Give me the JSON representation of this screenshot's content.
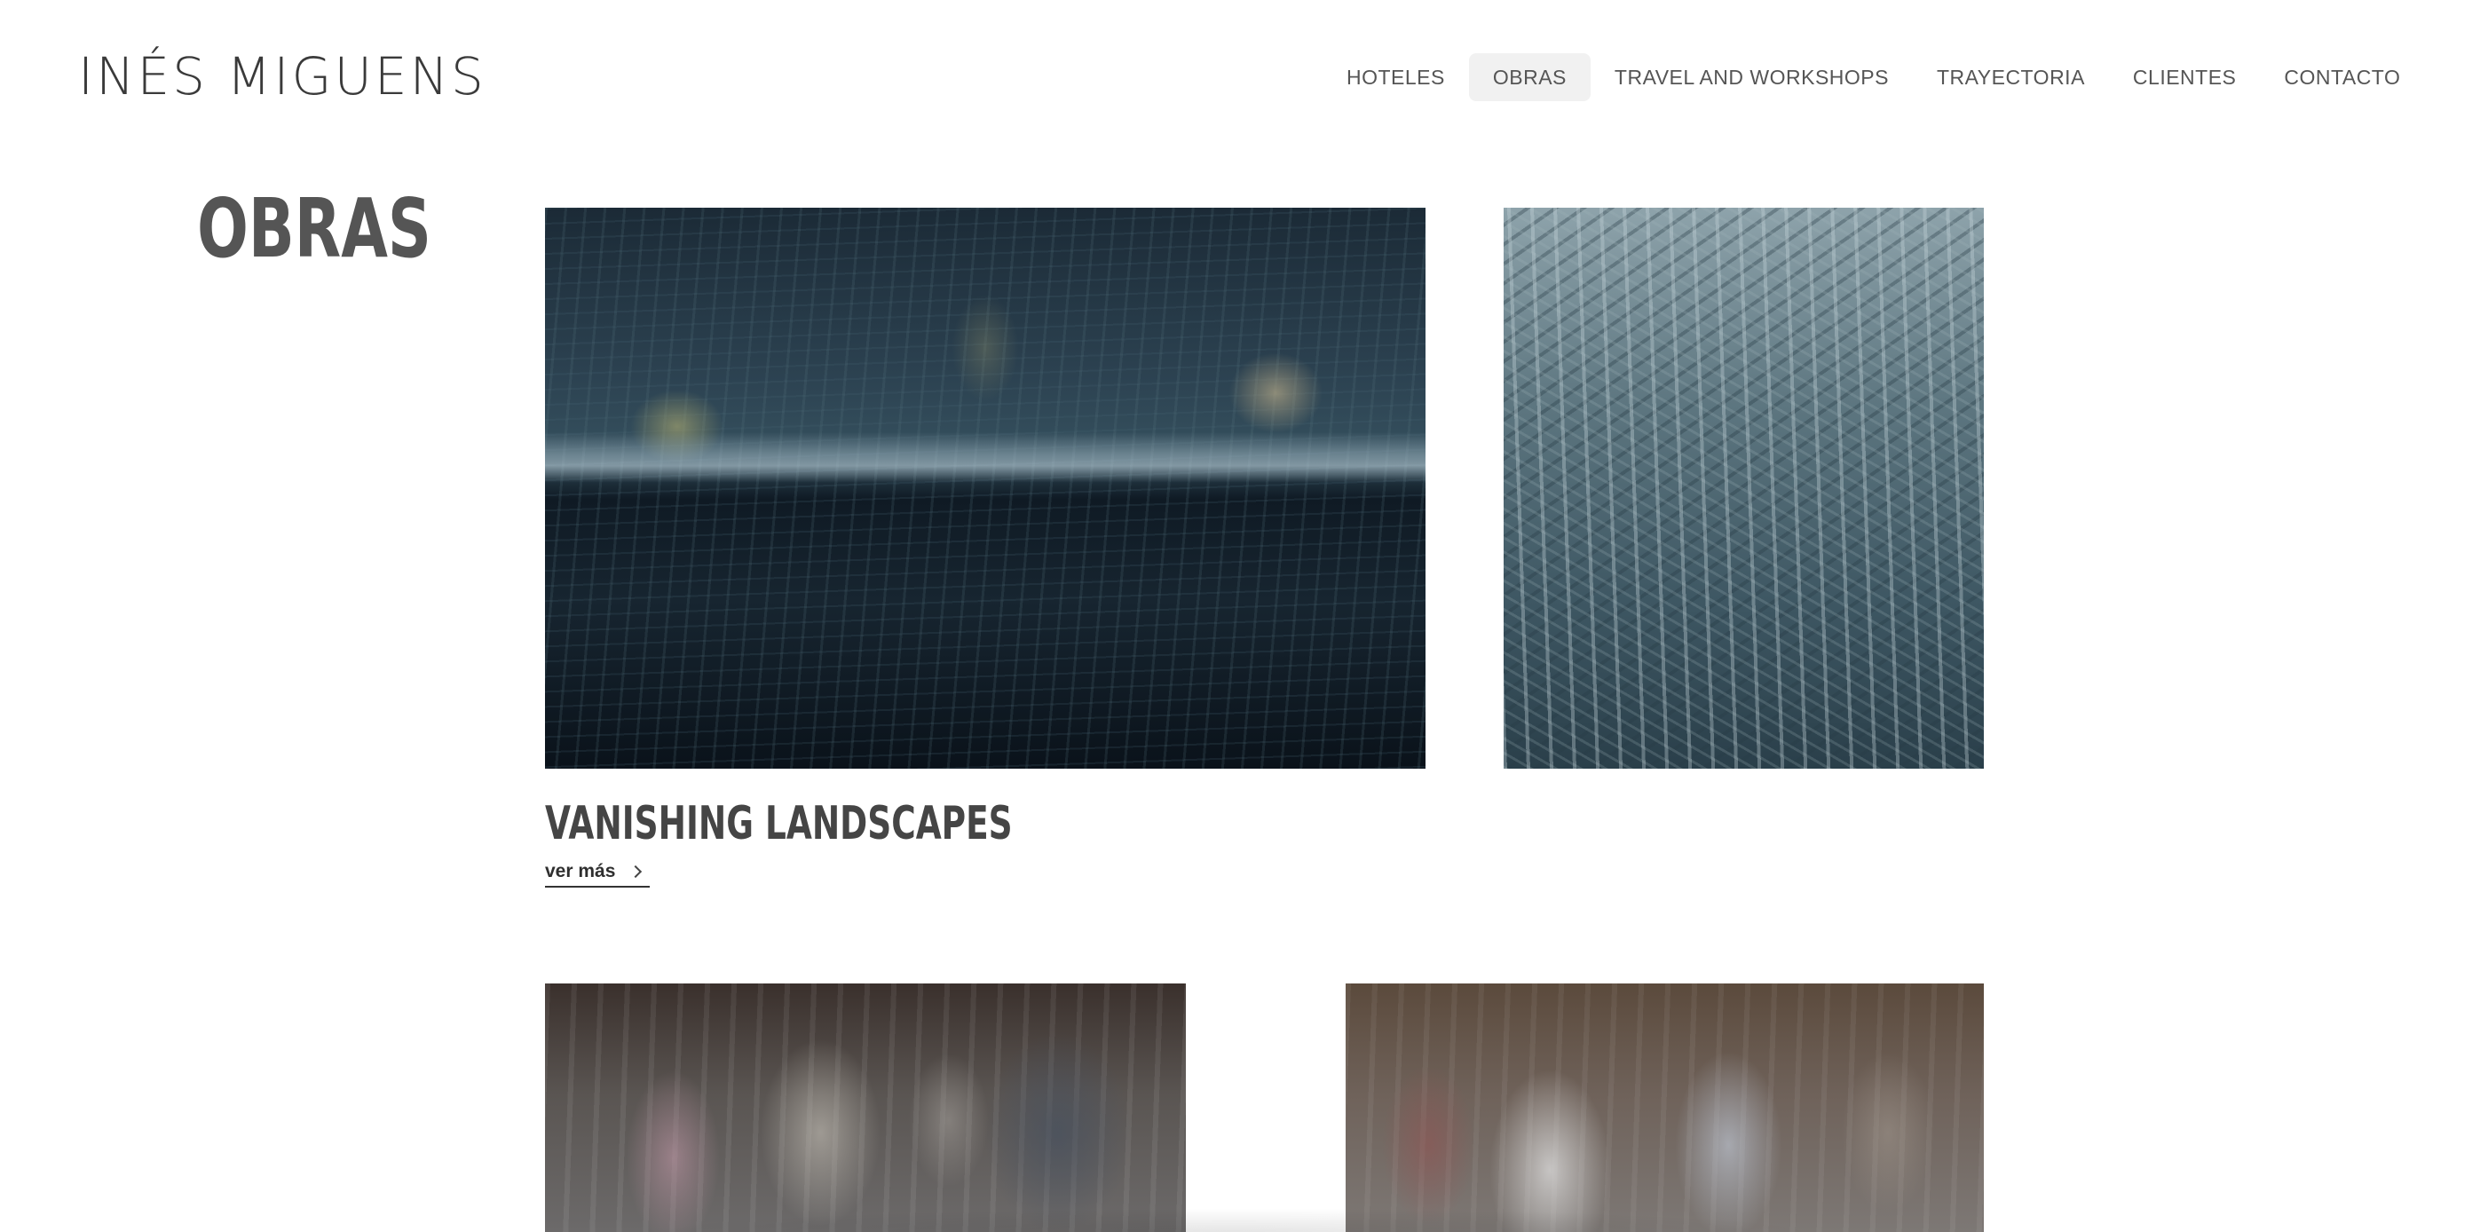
{
  "header": {
    "logo": "INÉS MIGUENS",
    "nav": [
      {
        "label": "HOTELES"
      },
      {
        "label": "OBRAS",
        "active": true
      },
      {
        "label": "TRAVEL AND WORKSHOPS"
      },
      {
        "label": "TRAYECTORIA"
      },
      {
        "label": "CLIENTES"
      },
      {
        "label": "CONTACTO"
      }
    ]
  },
  "main": {
    "page_title": "OBRAS",
    "series": [
      {
        "title": "VANISHING LANDSCAPES",
        "link_label": "ver más"
      }
    ]
  },
  "colors": {
    "text": "#333333",
    "nav_active_bg": "#f1f1f1",
    "heading": "#555555"
  }
}
